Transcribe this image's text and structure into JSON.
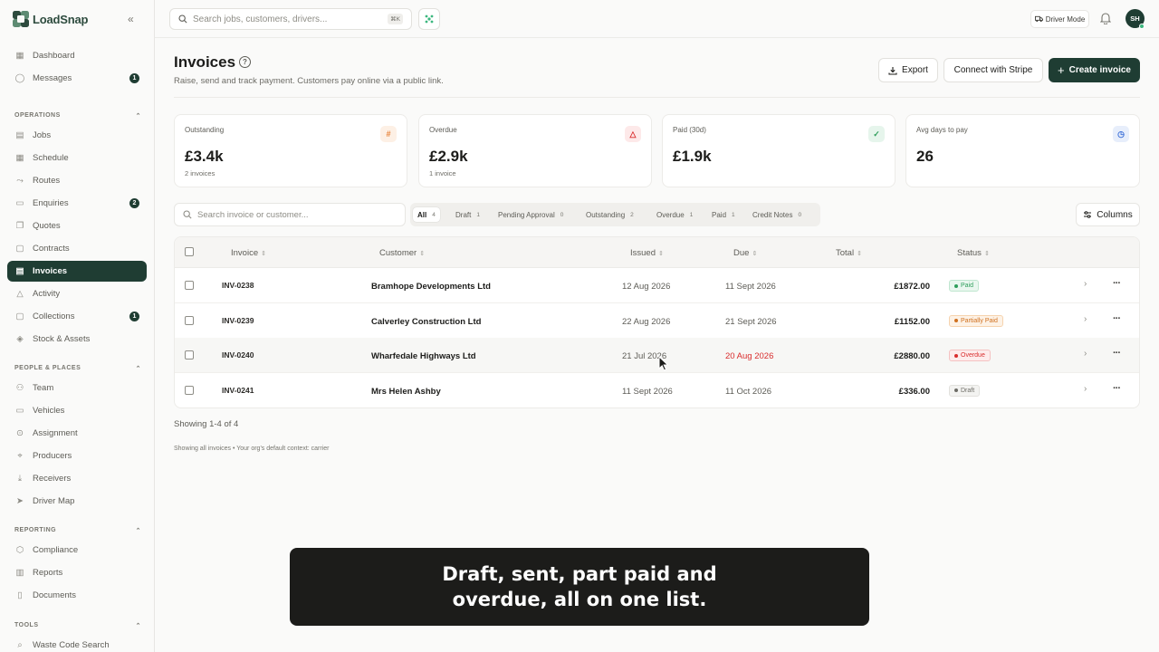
{
  "app": {
    "name": "LoadSnap",
    "collapse_icon": "«"
  },
  "sidebar": {
    "top_items": [
      {
        "label": "Dashboard",
        "icon": "grid-icon"
      },
      {
        "label": "Messages",
        "icon": "chat-icon",
        "badge": "1"
      }
    ],
    "sections": [
      {
        "title": "OPERATIONS",
        "items": [
          {
            "label": "Jobs",
            "icon": "clipboard-icon"
          },
          {
            "label": "Schedule",
            "icon": "calendar-icon"
          },
          {
            "label": "Routes",
            "icon": "route-icon"
          },
          {
            "label": "Enquiries",
            "icon": "inbox-icon",
            "badge": "2"
          },
          {
            "label": "Quotes",
            "icon": "quote-icon"
          },
          {
            "label": "Contracts",
            "icon": "contract-icon"
          },
          {
            "label": "Invoices",
            "icon": "invoice-icon",
            "active": true
          },
          {
            "label": "Activity",
            "icon": "activity-icon"
          },
          {
            "label": "Collections",
            "icon": "collections-icon",
            "badge": "1"
          },
          {
            "label": "Stock & Assets",
            "icon": "box-icon"
          }
        ]
      },
      {
        "title": "PEOPLE & PLACES",
        "items": [
          {
            "label": "Team",
            "icon": "team-icon"
          },
          {
            "label": "Vehicles",
            "icon": "truck-icon"
          },
          {
            "label": "Assignment",
            "icon": "link-icon"
          },
          {
            "label": "Producers",
            "icon": "pin-icon"
          },
          {
            "label": "Receivers",
            "icon": "download-icon"
          },
          {
            "label": "Driver Map",
            "icon": "navigation-icon"
          }
        ]
      },
      {
        "title": "REPORTING",
        "items": [
          {
            "label": "Compliance",
            "icon": "shield-icon"
          },
          {
            "label": "Reports",
            "icon": "bar-chart-icon"
          },
          {
            "label": "Documents",
            "icon": "document-icon"
          }
        ]
      },
      {
        "title": "TOOLS",
        "items": [
          {
            "label": "Waste Code Search",
            "icon": "search-icon"
          }
        ]
      }
    ]
  },
  "topbar": {
    "search_placeholder": "Search jobs, customers, drivers...",
    "shortcut": "⌘K",
    "driver_mode_label": "Driver Mode",
    "avatar_initials": "SH"
  },
  "header": {
    "title": "Invoices",
    "subtitle": "Raise, send and track payment. Customers pay online via a public link.",
    "export_label": "Export",
    "stripe_label": "Connect with Stripe",
    "create_label": "Create invoice"
  },
  "stats": [
    {
      "label": "Outstanding",
      "value": "£3.4k",
      "sub": "2 invoices",
      "icon": "hash-icon",
      "icon_color": "#e8833a",
      "icon_bg": "#fdf0e5"
    },
    {
      "label": "Overdue",
      "value": "£2.9k",
      "sub": "1 invoice",
      "icon": "alert-triangle-icon",
      "icon_color": "#d92d2d",
      "icon_bg": "#fde9e9"
    },
    {
      "label": "Paid (30d)",
      "value": "£1.9k",
      "sub": "",
      "icon": "check-circle-icon",
      "icon_color": "#2e9e5b",
      "icon_bg": "#e6f5ec"
    },
    {
      "label": "Avg days to pay",
      "value": "26",
      "sub": "",
      "icon": "clock-icon",
      "icon_color": "#3b6fd8",
      "icon_bg": "#e7eefb"
    }
  ],
  "table_controls": {
    "search_placeholder": "Search invoice or customer...",
    "filters": [
      {
        "label": "All",
        "count": "4",
        "active": true
      },
      {
        "label": "Draft",
        "count": "1"
      },
      {
        "label": "Pending Approval",
        "count": "0"
      },
      {
        "label": "Outstanding",
        "count": "2"
      },
      {
        "label": "Overdue",
        "count": "1"
      },
      {
        "label": "Paid",
        "count": "1"
      },
      {
        "label": "Credit Notes",
        "count": "0"
      }
    ],
    "columns_label": "Columns"
  },
  "table": {
    "headers": [
      "Invoice",
      "Customer",
      "Issued",
      "Due",
      "Total",
      "Status"
    ],
    "sort_glyph": "⇕",
    "rows": [
      {
        "invoice": "INV-0238",
        "customer": "Bramhope Developments Ltd",
        "issued": "12 Aug 2026",
        "due": "11 Sept 2026",
        "total": "£1872.00",
        "status": "Paid",
        "status_fg": "#2e9e5b",
        "status_bg": "#e9f7ef",
        "status_border": "#bfe6cf",
        "due_overdue": false
      },
      {
        "invoice": "INV-0239",
        "customer": "Calverley Construction Ltd",
        "issued": "22 Aug 2026",
        "due": "21 Sept 2026",
        "total": "£1152.00",
        "status": "Partially Paid",
        "status_fg": "#d0711f",
        "status_bg": "#fdf2e6",
        "status_border": "#f6d3ae",
        "due_overdue": false
      },
      {
        "invoice": "INV-0240",
        "customer": "Wharfedale Highways Ltd",
        "issued": "21 Jul 2026",
        "due": "20 Aug 2026",
        "total": "£2880.00",
        "status": "Overdue",
        "status_fg": "#d92d2d",
        "status_bg": "#fdecec",
        "status_border": "#f5c2c2",
        "due_overdue": true
      },
      {
        "invoice": "INV-0241",
        "customer": "Mrs Helen Ashby",
        "issued": "11 Sept 2026",
        "due": "11 Oct 2026",
        "total": "£336.00",
        "status": "Draft",
        "status_fg": "#6d6c66",
        "status_bg": "#f3f3f1",
        "status_border": "#e2e1dd",
        "due_overdue": false
      }
    ]
  },
  "footer": {
    "showing": "Showing 1-4 of 4",
    "context": "Showing all invoices • Your org's default context: carrier"
  },
  "caption": {
    "line1": "Draft, sent, part paid and",
    "line2": "overdue, all on one list."
  }
}
